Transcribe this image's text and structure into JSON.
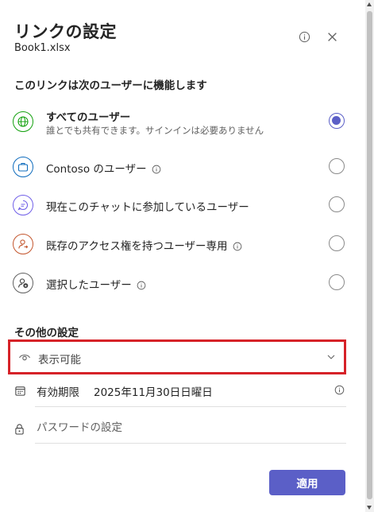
{
  "header": {
    "title": "リンクの設定",
    "filename": "Book1.xlsx",
    "info_icon": "info-icon",
    "close_icon": "close-icon"
  },
  "section_link": {
    "title": "このリンクは次のユーザーに機能します",
    "options": [
      {
        "label": "すべてのユーザー",
        "sub": "誰とでも共有できます。サインインは必要ありません",
        "icon": "globe-icon",
        "has_info": false,
        "selected": true
      },
      {
        "label": "Contoso のユーザー",
        "icon": "briefcase-icon",
        "has_info": true,
        "selected": false
      },
      {
        "label": "現在このチャットに参加しているユーザー",
        "icon": "chat-icon",
        "has_info": false,
        "selected": false
      },
      {
        "label": "既存のアクセス権を持つユーザー専用",
        "icon": "person-arrow-icon",
        "has_info": true,
        "selected": false
      },
      {
        "label": "選択したユーザー",
        "icon": "person-lock-icon",
        "has_info": true,
        "selected": false
      }
    ]
  },
  "section_other": {
    "title": "その他の設定",
    "permission": {
      "value": "表示可能",
      "icon": "eye-icon"
    },
    "expiry": {
      "label": "有効期限",
      "value": "2025年11月30日日曜日",
      "icon": "calendar-icon"
    },
    "password": {
      "placeholder": "パスワードの設定",
      "icon": "lock-icon"
    }
  },
  "footer": {
    "apply_label": "適用"
  },
  "colors": {
    "accent": "#5b5fc7",
    "highlight_border": "#d62228",
    "globe": "#13a10e",
    "briefcase": "#0f6cbd",
    "chat": "#7160e8",
    "person": "#c4572f",
    "neutral": "#616161"
  }
}
